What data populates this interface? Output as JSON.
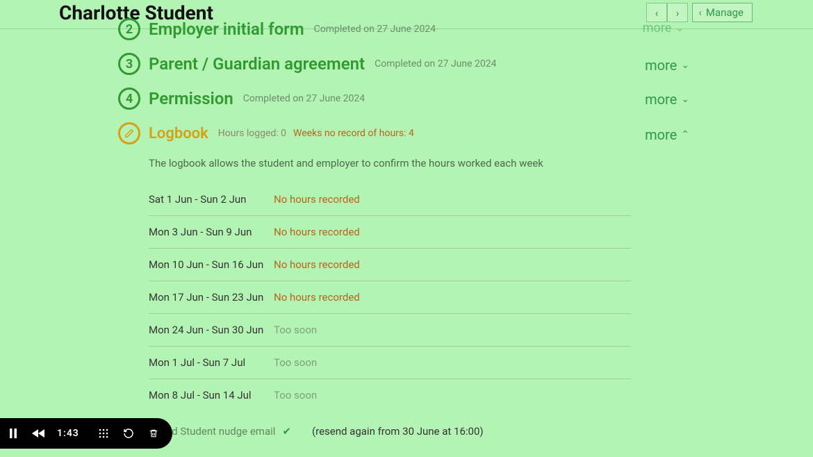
{
  "header": {
    "title": "Charlotte Student",
    "manage_label": "Manage"
  },
  "more_label": "more",
  "steps": [
    {
      "num": "2",
      "title": "Employer initial form",
      "meta": "Completed on 27 June 2024"
    },
    {
      "num": "3",
      "title": "Parent / Guardian agreement",
      "meta": "Completed on 27 June 2024"
    },
    {
      "num": "4",
      "title": "Permission",
      "meta": "Completed on 27 June 2024"
    }
  ],
  "logbook": {
    "title": "Logbook",
    "hours_logged": "Hours logged: 0",
    "weeks_norecord": "Weeks no record of hours: 4",
    "desc": "The logbook allows the student and employer to confirm the hours worked each week",
    "weeks": [
      {
        "range": "Sat 1 Jun - Sun 2 Jun",
        "status": "No hours recorded",
        "kind": "nohours"
      },
      {
        "range": "Mon 3 Jun - Sun 9 Jun",
        "status": "No hours recorded",
        "kind": "nohours"
      },
      {
        "range": "Mon 10 Jun - Sun 16 Jun",
        "status": "No hours recorded",
        "kind": "nohours"
      },
      {
        "range": "Mon 17 Jun - Sun 23 Jun",
        "status": "No hours recorded",
        "kind": "nohours"
      },
      {
        "range": "Mon 24 Jun - Sun 30 Jun",
        "status": "Too soon",
        "kind": "soon"
      },
      {
        "range": "Mon 1 Jul - Sun 7 Jul",
        "status": "Too soon",
        "kind": "soon"
      },
      {
        "range": "Mon 8 Jul - Sun 14 Jul",
        "status": "Too soon",
        "kind": "soon"
      }
    ],
    "nudge_label": "Send Student nudge email",
    "nudge_resend": "(resend again from 30 June at 16:00)"
  },
  "player": {
    "time": "1:43"
  }
}
